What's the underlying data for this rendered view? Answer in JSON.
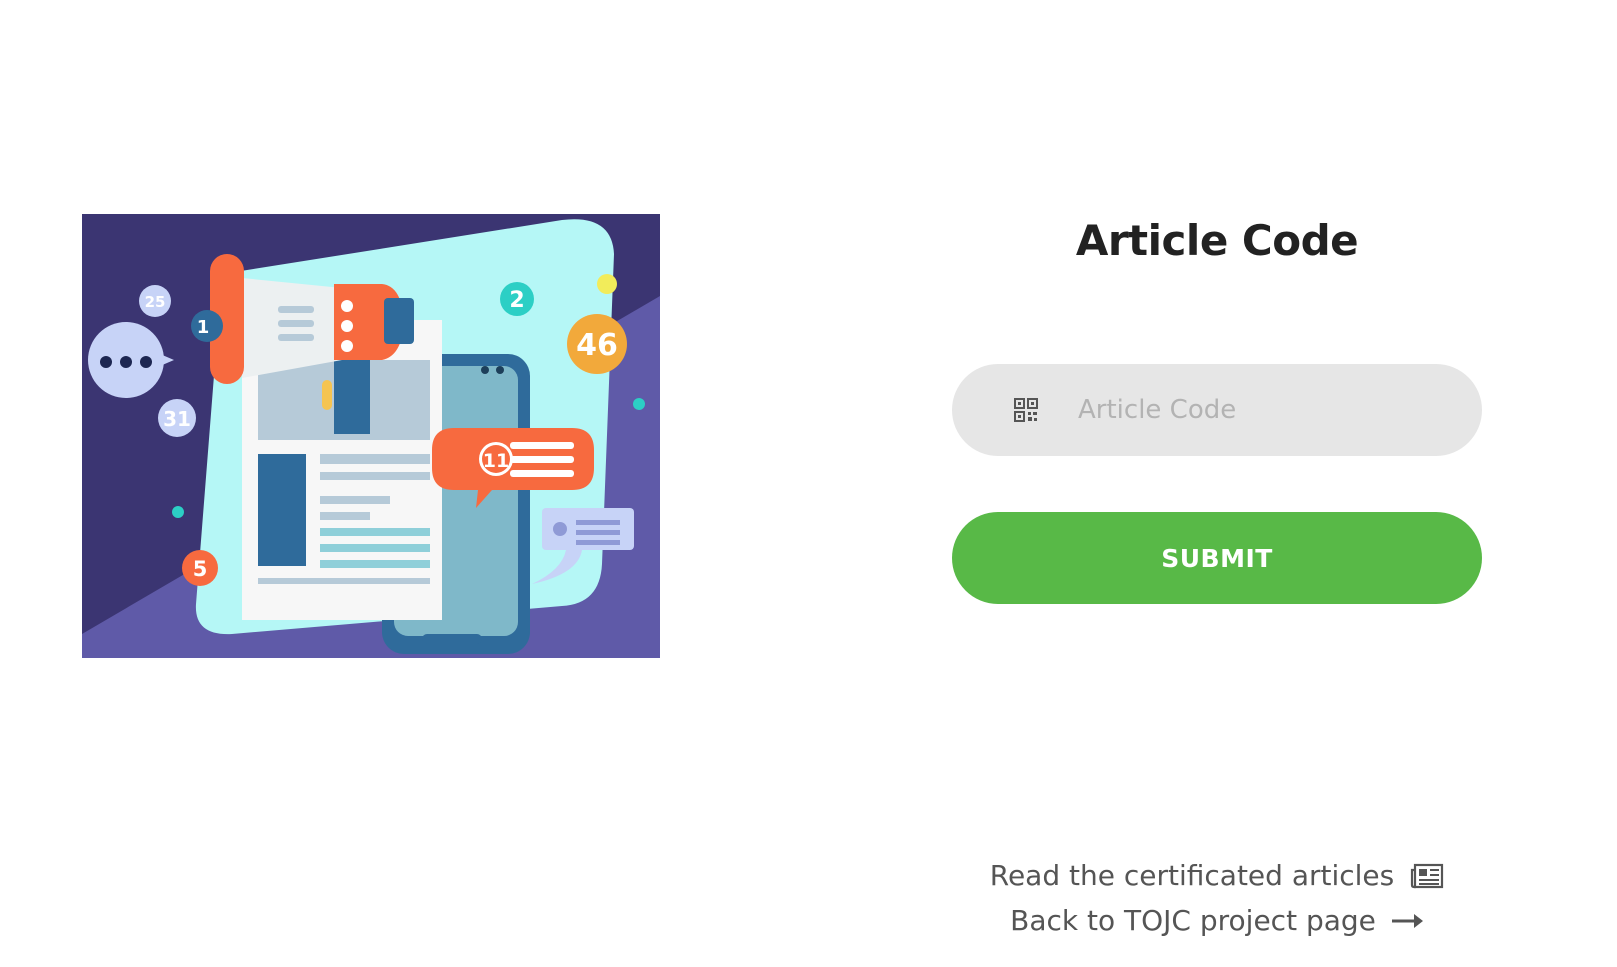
{
  "form": {
    "title": "Article Code",
    "input_placeholder": "Article Code",
    "input_value": "",
    "input_icon": "qr-code-icon",
    "submit_label": "SUBMIT"
  },
  "illustration": {
    "badges": [
      "25",
      "1",
      "31",
      "2",
      "46",
      "11",
      "5"
    ]
  },
  "links": {
    "read_articles": "Read the certificated articles",
    "read_articles_icon": "newspaper-icon",
    "back_to_project": "Back to TOJC project page",
    "back_to_project_icon": "arrow-right-icon"
  },
  "colors": {
    "submit_bg": "#58b947",
    "input_bg": "#e6e6e6",
    "title": "#222222",
    "link_text": "#555555"
  }
}
